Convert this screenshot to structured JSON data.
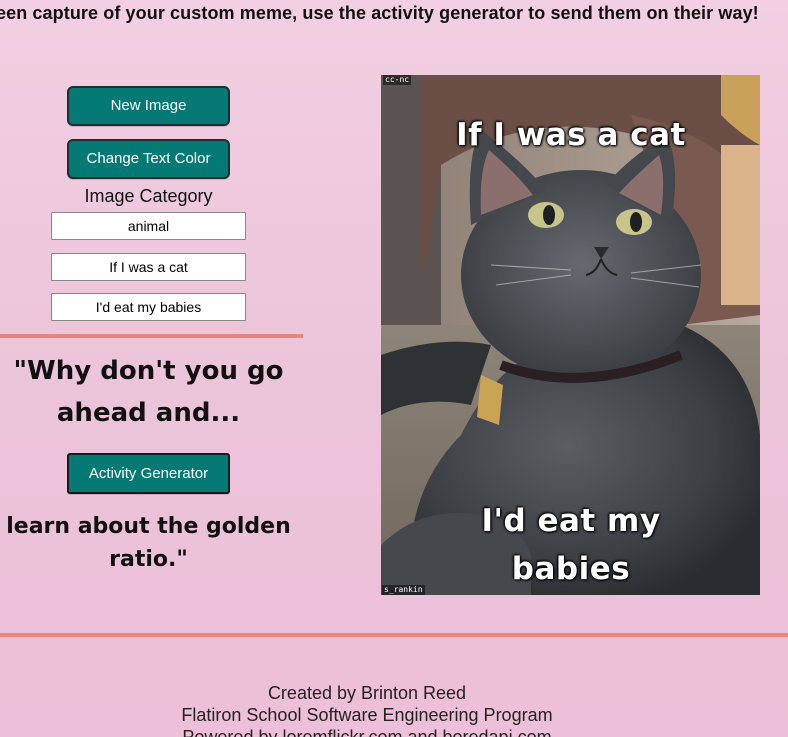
{
  "header": {
    "banner_text": "een capture of your custom meme, use the activity generator to send them on their way!"
  },
  "controls": {
    "new_image_label": "New Image",
    "change_text_color_label": "Change Text Color",
    "image_category_label": "Image Category",
    "category_value": "animal",
    "top_text_value": "If I was a cat",
    "bottom_text_value": "I'd eat my babies"
  },
  "activity": {
    "prompt_line1": "\"Why don't you go",
    "prompt_line2": "ahead and...",
    "button_label": "Activity Generator",
    "result_line1": "learn about the golden",
    "result_line2": "ratio.\""
  },
  "meme": {
    "top_text": "If I was a cat",
    "bottom_text_line1": "I'd eat my",
    "bottom_text_line2": "babies",
    "license_label": "cc-nc",
    "author_label": "s_rankin",
    "image_icon": "cat-photo"
  },
  "footer": {
    "line1": "Created by Brinton Reed",
    "line2": "Flatiron School Software Engineering Program",
    "line3": "Powered by loremflickr.com and boredapi.com"
  },
  "colors": {
    "button_bg": "#057a75",
    "divider": "#e9857b",
    "page_bg": "#f0c8de"
  }
}
